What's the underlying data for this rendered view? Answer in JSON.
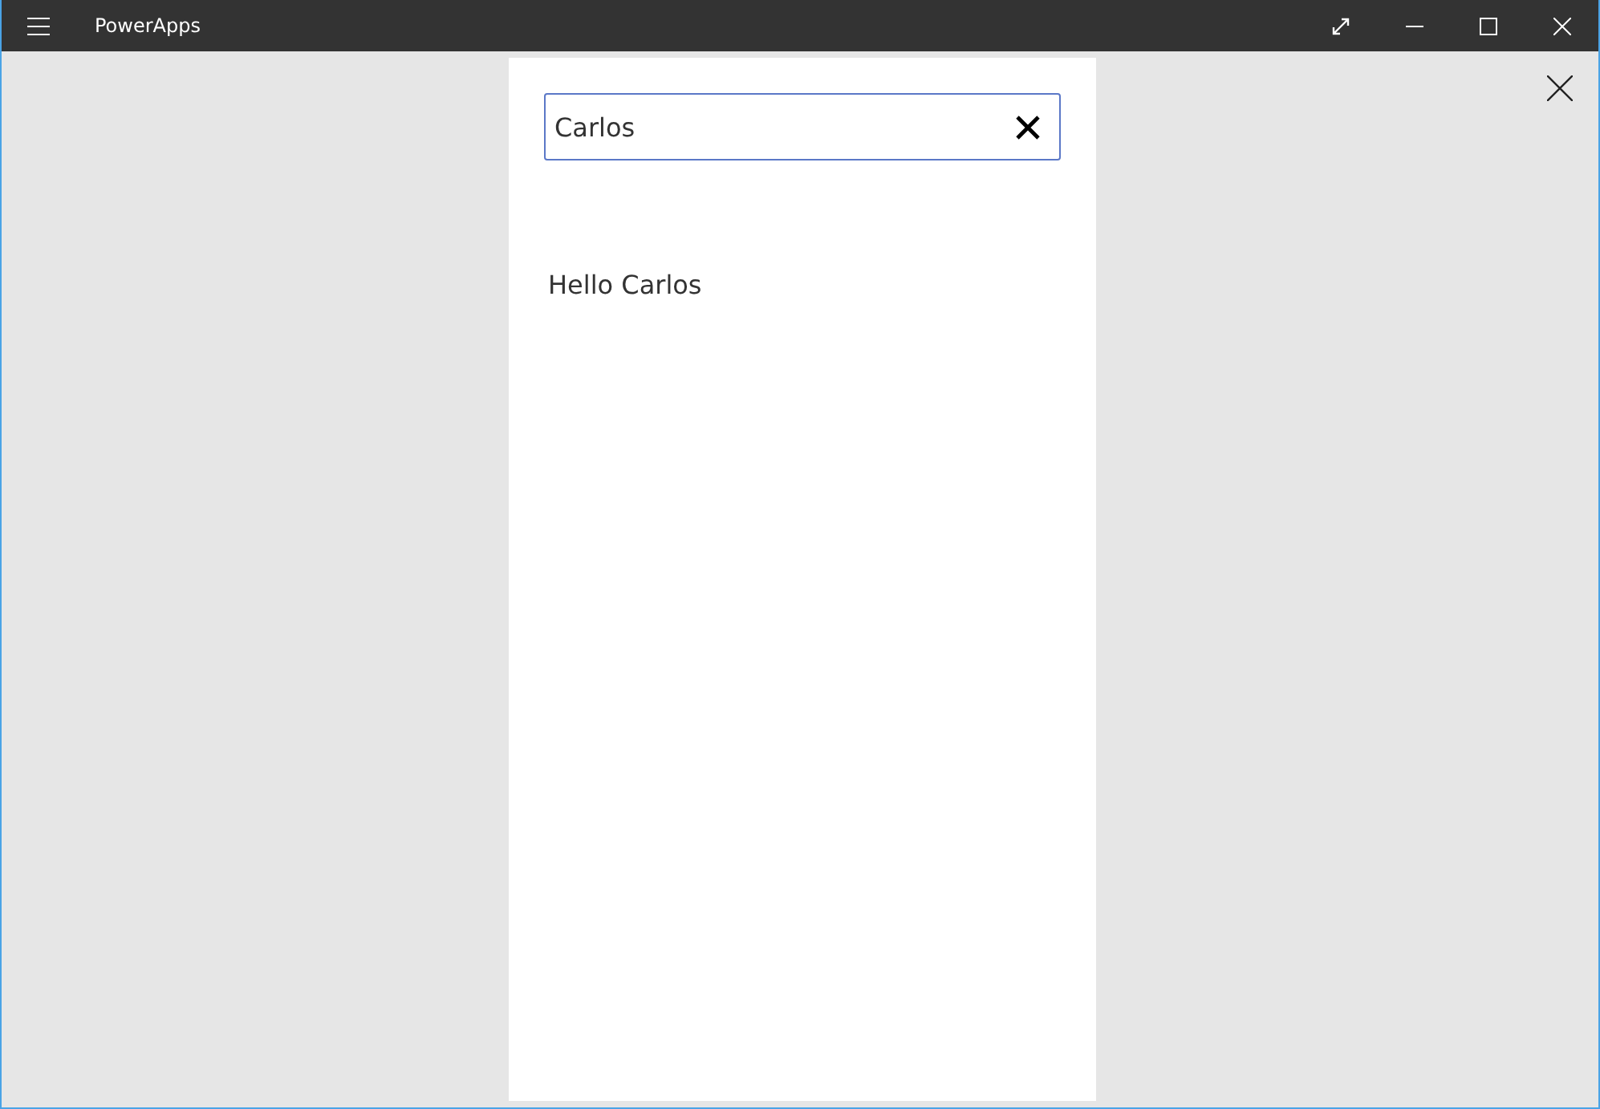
{
  "window": {
    "title": "PowerApps"
  },
  "app": {
    "search": {
      "value": "Carlos"
    },
    "greeting": "Hello Carlos"
  }
}
